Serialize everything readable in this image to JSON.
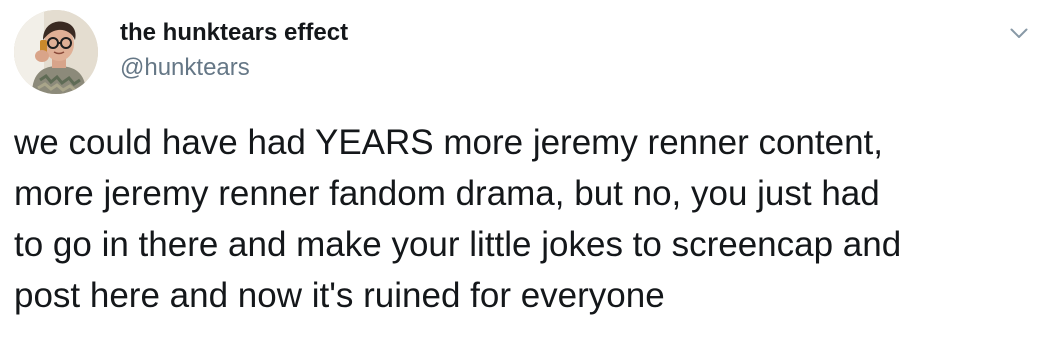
{
  "author": {
    "display_name": "the hunktears effect",
    "handle": "@hunktears",
    "avatar_icon": "profile-photo"
  },
  "menu": {
    "icon": "chevron-down-icon"
  },
  "tweet": {
    "lines": [
      "we could have had YEARS more jeremy renner content,",
      "more jeremy renner fandom drama, but no, you just had",
      "to go in there and make your little jokes to screencap and",
      "post here and now it's ruined for everyone"
    ]
  },
  "colors": {
    "text": "#14171a",
    "secondary": "#657786",
    "background": "#ffffff"
  }
}
